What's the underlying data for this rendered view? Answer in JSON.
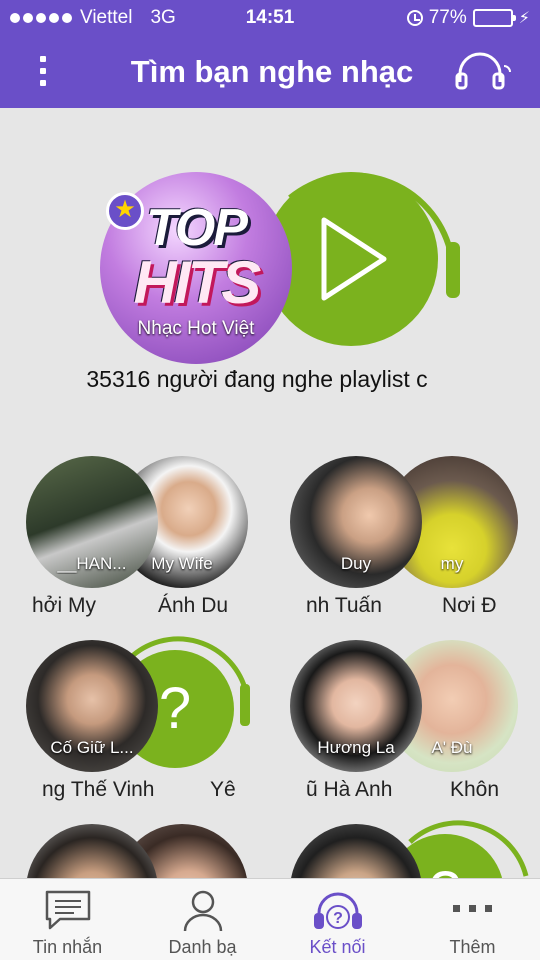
{
  "status": {
    "signal_dots": 5,
    "carrier": "Viettel",
    "network": "3G",
    "time": "14:51",
    "battery_pct": "77%",
    "battery_fill": 0.77
  },
  "header": {
    "title": "Tìm bạn nghe nhạc",
    "menu_icon": "vertical-dots-icon",
    "right_icon": "headphones-icon"
  },
  "hero": {
    "cover_top": "TOP",
    "cover_hits": "HITS",
    "cover_label": "Nhạc Hot Việt",
    "badge_icon": "star-icon",
    "play_icon": "play-icon",
    "listeners_text": "35316 người đang nghe playlist c"
  },
  "pairs": [
    {
      "a_label": "__HAN...",
      "b_label": "My Wife",
      "left_name": "hởi My",
      "right_name": "Ánh Du"
    },
    {
      "a_label": "Duy",
      "b_label": "my",
      "left_name": "nh Tuấn",
      "right_name": "Nơi Đ"
    },
    {
      "a_label": "Cố Giữ L...",
      "b_label": "?",
      "left_name": "ng Thế Vinh",
      "right_name": "Yê"
    },
    {
      "a_label": "Hương La",
      "b_label": "A' Đù",
      "left_name": "ũ Hà Anh",
      "right_name": "Khôn"
    },
    {
      "a_label": "",
      "b_label": "",
      "left_name": "",
      "right_name": ""
    },
    {
      "a_label": "",
      "b_label": "?",
      "left_name": "",
      "right_name": ""
    }
  ],
  "tabs": [
    {
      "label": "Tin nhắn",
      "icon": "message-icon"
    },
    {
      "label": "Danh bạ",
      "icon": "contact-icon"
    },
    {
      "label": "Kết nối",
      "icon": "headphones-question-icon"
    },
    {
      "label": "Thêm",
      "icon": "more-dots-icon"
    }
  ],
  "colors": {
    "header": "#6a4fc8",
    "accent_green": "#7bb21e",
    "active_tab": "#6a4fc8"
  }
}
